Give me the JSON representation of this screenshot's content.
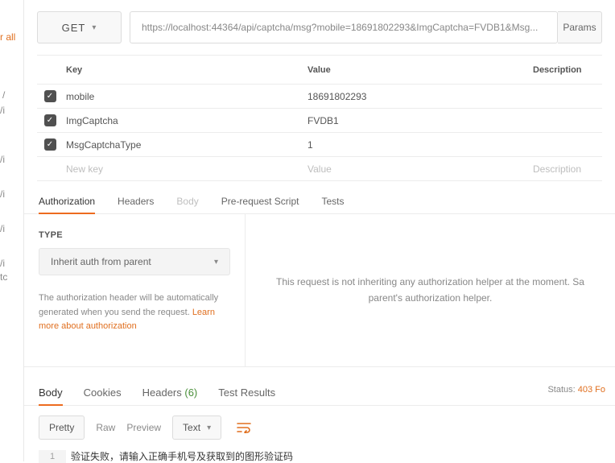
{
  "sidebar": {
    "rall": "r all",
    "slash_i": "/i",
    "tc": "tc",
    "slash": "/"
  },
  "request": {
    "method": "GET",
    "url": "https://localhost:44364/api/captcha/msg?mobile=18691802293&ImgCaptcha=FVDB1&Msg...",
    "params_label": "Params"
  },
  "params": {
    "header_key": "Key",
    "header_value": "Value",
    "header_desc": "Description",
    "rows": [
      {
        "key": "mobile",
        "value": "18691802293"
      },
      {
        "key": "ImgCaptcha",
        "value": "FVDB1"
      },
      {
        "key": "MsgCaptchaType",
        "value": "1"
      }
    ],
    "new_key": "New key",
    "new_value": "Value",
    "new_desc": "Description"
  },
  "tabs": {
    "authorization": "Authorization",
    "headers": "Headers",
    "body": "Body",
    "prerequest": "Pre-request Script",
    "tests": "Tests"
  },
  "auth": {
    "type_label": "TYPE",
    "selected": "Inherit auth from parent",
    "note_pre": "The authorization header will be automatically generated when you send the request. ",
    "note_link": "Learn more about authorization",
    "right_text": "This request is not inheriting any authorization helper at the moment. Sa parent's authorization helper."
  },
  "response_tabs": {
    "body": "Body",
    "cookies": "Cookies",
    "headers": "Headers",
    "headers_count": "(6)",
    "test_results": "Test Results",
    "status_label": "Status:",
    "status_code": "403 Fo"
  },
  "toolbar": {
    "pretty": "Pretty",
    "raw": "Raw",
    "preview": "Preview",
    "text": "Text"
  },
  "response_body": {
    "line_no": "1",
    "text": "验证失败，请输入正确手机号及获取到的图形验证码"
  }
}
